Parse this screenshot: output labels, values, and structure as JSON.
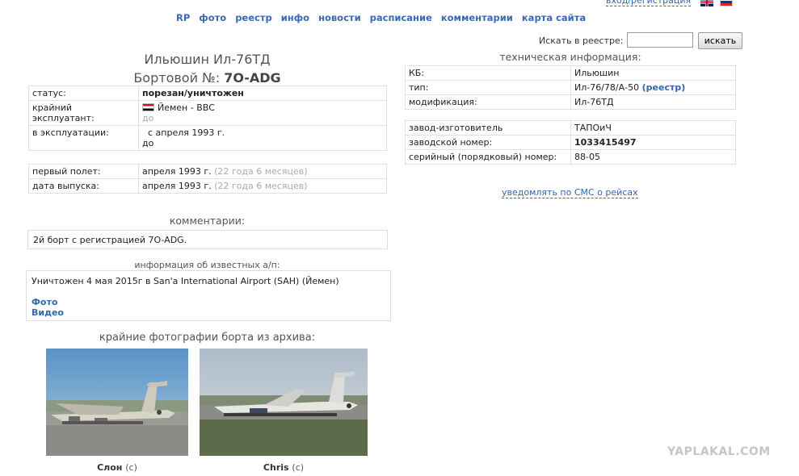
{
  "nav": {
    "items": [
      "RP",
      "фото",
      "реестр",
      "инфо",
      "новости",
      "расписание",
      "комментарии",
      "карта сайта"
    ],
    "login": "вход/регистрация"
  },
  "search": {
    "label": "Искать в реестре:",
    "value": "",
    "button": "искать"
  },
  "header": {
    "aircraft": "Ильюшин Ил-76ТД",
    "reg_prefix": "Бортовой №:",
    "reg": "7O-ADG"
  },
  "status_table": {
    "status_label": "статус:",
    "status_value": "порезан/уничтожен",
    "operator_label": "крайний эксплуатант:",
    "operator_value": "Йемен - ВВС",
    "operator_until": "до",
    "service_label": "в эксплуатации:",
    "service_from": "с апреля 1993 г.",
    "service_until": "до"
  },
  "dates_table": {
    "first_flight_label": "первый полет:",
    "first_flight_value": "апреля 1993 г.",
    "first_flight_age": "(22 года 6 месяцев)",
    "release_label": "дата выпуска:",
    "release_value": "апреля 1993 г.",
    "release_age": "(22 года 6 месяцев)"
  },
  "comments": {
    "title": "комментарии:",
    "text": "2й борт с регистрацией 7O-ADG."
  },
  "airport_info": {
    "title": "информация об известных а/п:",
    "text": "Уничтожен 4 мая 2015г в San'a International Airport (SAH) (Йемен)",
    "photo_link": "Фото",
    "video_link": "Видео"
  },
  "photos": {
    "title": "крайние фотографии борта из архива:",
    "items": [
      {
        "author": "Слон",
        "copy": "(c)"
      },
      {
        "author": "Chris",
        "copy": "(c)"
      }
    ]
  },
  "tech": {
    "title": "техническая информация:",
    "kb_label": "КБ:",
    "kb_value": "Ильюшин",
    "type_label": "тип:",
    "type_value": "Ил-76/78/А-50",
    "type_link": "(реестр)",
    "mod_label": "модификация:",
    "mod_value": "Ил-76ТД",
    "factory_label": "завод-изготовитель",
    "factory_value": "ТАПОиЧ",
    "serial_label": "заводской номер:",
    "serial_value": "1033415497",
    "line_label": "серийный (порядковый) номер:",
    "line_value": "88-05"
  },
  "sms_link": "уведомлять по СМС о рейсах",
  "watermark": "YAPLAKAL.COM"
}
